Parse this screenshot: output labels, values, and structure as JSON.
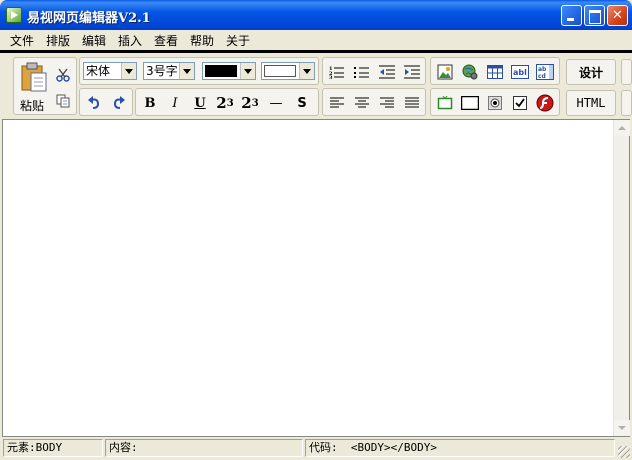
{
  "window": {
    "title": "易视网页编辑器V2.1"
  },
  "menu": [
    "文件",
    "排版",
    "编辑",
    "插入",
    "查看",
    "帮助",
    "关于"
  ],
  "toolbar": {
    "paste_label": "粘贴",
    "font_family": "宋体",
    "font_size": "3号字",
    "fore_color": "#000000",
    "back_color": "#ffffff",
    "bold": "B",
    "italic": "I",
    "underline": "U",
    "superscript_base": "2",
    "superscript_sup": "3",
    "subscript_base": "2",
    "subscript_sub": "3",
    "hr": "—",
    "strike": "S",
    "design_label": "设计",
    "html_label": "HTML"
  },
  "status": {
    "element": "元素:BODY",
    "content": "内容:",
    "code_label": "代码:",
    "code_value": "<BODY></BODY>"
  }
}
